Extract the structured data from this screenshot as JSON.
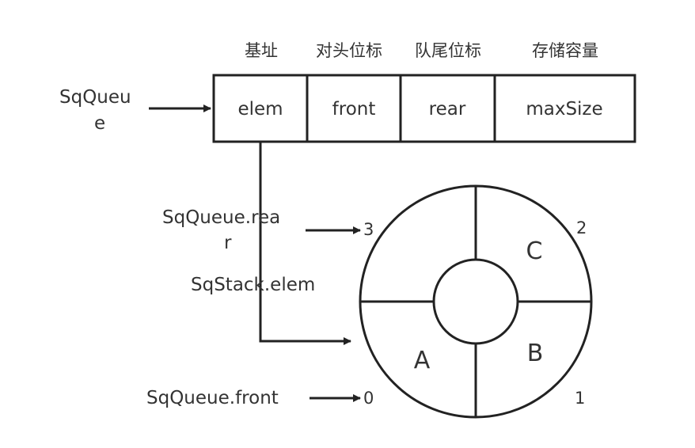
{
  "header": {
    "base_address": "基址",
    "front_index": "对头位标",
    "rear_index": "队尾位标",
    "capacity": "存储容量"
  },
  "struct": {
    "pointer_label_line1": "SqQueu",
    "pointer_label_line2": "e",
    "fields": [
      "elem",
      "front",
      "rear",
      "maxSize"
    ]
  },
  "ring": {
    "rear_label_line1": "SqQueue.rea",
    "rear_label_line2": "r",
    "elem_label": "SqStack.elem",
    "front_label": "SqQueue.front",
    "indices": [
      "3",
      "2",
      "0",
      "1"
    ],
    "cells": [
      "C",
      "A",
      "B"
    ]
  },
  "colors": {
    "stroke": "#222222",
    "text": "#333333",
    "background": "#ffffff"
  }
}
